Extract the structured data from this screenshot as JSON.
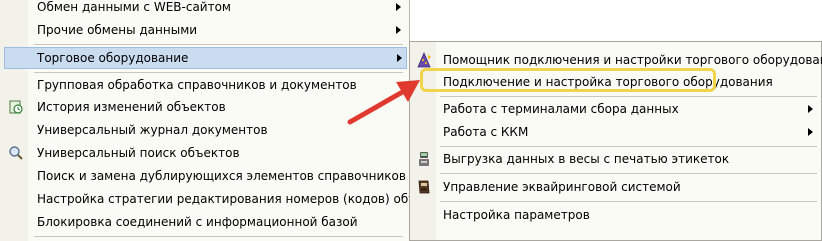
{
  "main_menu": {
    "items": [
      {
        "label": "Обмен данными с WEB-сайтом",
        "has_submenu": true
      },
      {
        "label": "Прочие обмены данными",
        "has_submenu": true
      },
      {
        "label": "Торговое оборудование",
        "has_submenu": true,
        "selected": true
      },
      {
        "label": "Групповая обработка справочников и документов"
      },
      {
        "label": "История изменений объектов",
        "icon": "history-icon"
      },
      {
        "label": "Универсальный журнал документов"
      },
      {
        "label": "Универсальный поиск объектов",
        "icon": "magnifier-icon"
      },
      {
        "label": "Поиск и замена дублирующихся элементов справочников"
      },
      {
        "label": "Настройка стратегии редактирования номеров (кодов) объектов"
      },
      {
        "label": "Блокировка соединений с информационной базой"
      }
    ]
  },
  "submenu": {
    "items": [
      {
        "label": "Помощник подключения и настройки торгового оборудования",
        "icon": "wizard-hat-icon"
      },
      {
        "label": "Подключение и настройка торгового оборудования",
        "highlighted": true
      },
      {
        "label": "Работа с терминалами сбора данных",
        "has_submenu": true
      },
      {
        "label": "Работа с ККМ",
        "has_submenu": true
      },
      {
        "label": "Выгрузка данных в весы с печатью этикеток",
        "icon": "scales-icon"
      },
      {
        "label": "Управление эквайринговой системой",
        "icon": "card-terminal-icon"
      },
      {
        "label": "Настройка параметров"
      }
    ]
  },
  "colors": {
    "selection": "#c9dcf0",
    "highlight_box": "#f0d44a",
    "annotation_arrow": "#e03a2f"
  }
}
